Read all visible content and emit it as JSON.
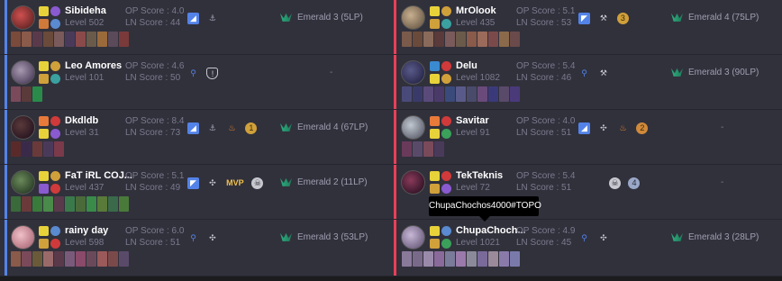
{
  "teams": [
    {
      "side": "blue",
      "players": [
        {
          "name": "Sibideha",
          "level": "Level 502",
          "op": "OP Score : 4.0",
          "ln": "LN Score : 44",
          "rank": "Emerald 3 (5LP)",
          "champ_color": "#8c3a3a",
          "items": 11,
          "badges": [
            "bot",
            "fill"
          ]
        },
        {
          "name": "Leo Amores",
          "level": "Level 101",
          "op": "OP Score : 4.6",
          "ln": "LN Score : 50",
          "rank": "",
          "dash": "-",
          "champ_color": "#6b5a7a",
          "items": 3,
          "badges": [
            "jungle",
            "shield"
          ]
        },
        {
          "name": "Dkdldb",
          "level": "Level 31",
          "op": "OP Score : 8.4",
          "ln": "LN Score : 73",
          "rank": "Emerald 4 (67LP)",
          "champ_color": "#3a2a3a",
          "items": 5,
          "badges": [
            "bot",
            "fill",
            "fire",
            "medal"
          ]
        },
        {
          "name": "FaT iRL COJ...",
          "level": "Level 437",
          "op": "OP Score : 5.1",
          "ln": "LN Score : 49",
          "rank": "Emerald 2 (11LP)",
          "champ_color": "#3a5a3a",
          "items": 11,
          "badges": [
            "top",
            "mid",
            "mvp",
            "skull"
          ]
        },
        {
          "name": "rainy day",
          "level": "Level 598",
          "op": "OP Score : 6.0",
          "ln": "LN Score : 51",
          "rank": "Emerald 3 (53LP)",
          "champ_color": "#e09aa8",
          "items": 11,
          "badges": [
            "jungle",
            "mid"
          ]
        }
      ]
    },
    {
      "side": "red",
      "players": [
        {
          "name": "MrOlook",
          "level": "Level 435",
          "op": "OP Score : 5.1",
          "ln": "LN Score : 53",
          "rank": "Emerald 4 (75LP)",
          "champ_color": "#b09a7a",
          "items": 11,
          "badges": [
            "top",
            "axe",
            "medal"
          ]
        },
        {
          "name": "Delu",
          "level": "Level 1082",
          "op": "OP Score : 5.4",
          "ln": "LN Score : 46",
          "rank": "Emerald 3 (90LP)",
          "champ_color": "#3a3a5a",
          "items": 11,
          "badges": [
            "jungle",
            "axe"
          ]
        },
        {
          "name": "Savitar",
          "level": "Level 91",
          "op": "OP Score : 4.0",
          "ln": "LN Score : 51",
          "rank": "",
          "dash": "-",
          "champ_color": "#9aa0a8",
          "items": 4,
          "badges": [
            "bot",
            "mid",
            "fire",
            "medal"
          ]
        },
        {
          "name": "TekTeknis",
          "level": "Level 72",
          "op": "OP Score : 5.4",
          "ln": "LN Score : 51",
          "rank": "",
          "dash": "-",
          "champ_color": "#3a1a3a",
          "items": 0,
          "badges": [
            "",
            "",
            "skull",
            "medal"
          ]
        },
        {
          "name": "ChupaChoch...",
          "level": "Level 1021",
          "op": "OP Score : 4.9",
          "ln": "LN Score : 45",
          "rank": "Emerald 3 (28LP)",
          "champ_color": "#a89ab0",
          "items": 11,
          "badges": [
            "jungle",
            "mid"
          ]
        }
      ]
    }
  ],
  "tooltip": "ChupaChochos4000#TOPO",
  "badge_labels": {
    "mvp": "MVP"
  },
  "colors": {
    "blue_team": "#5383e8",
    "red_team": "#e84057",
    "emerald": "#2daf7f"
  }
}
